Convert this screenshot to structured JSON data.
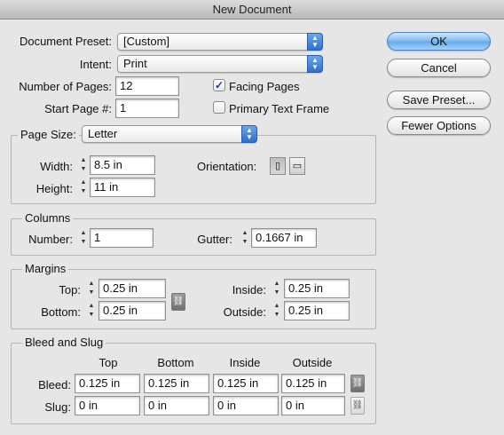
{
  "window": {
    "title": "New Document"
  },
  "document_preset": {
    "label": "Document Preset:",
    "value": "[Custom]"
  },
  "intent": {
    "label": "Intent:",
    "value": "Print"
  },
  "number_of_pages": {
    "label": "Number of Pages:",
    "value": "12"
  },
  "start_page": {
    "label": "Start Page #:",
    "value": "1"
  },
  "facing_pages": {
    "label": "Facing Pages",
    "checked": true,
    "mark": "✓"
  },
  "primary_text_frame": {
    "label": "Primary Text Frame",
    "checked": false
  },
  "buttons": {
    "ok": "OK",
    "cancel": "Cancel",
    "save_preset": "Save Preset...",
    "fewer_options": "Fewer Options"
  },
  "page_size": {
    "label": "Page Size:",
    "value": "Letter",
    "width_label": "Width:",
    "width": "8.5 in",
    "height_label": "Height:",
    "height": "11 in",
    "orientation_label": "Orientation:"
  },
  "columns": {
    "title": "Columns",
    "number_label": "Number:",
    "number": "1",
    "gutter_label": "Gutter:",
    "gutter": "0.1667 in"
  },
  "margins": {
    "title": "Margins",
    "top_label": "Top:",
    "top": "0.25 in",
    "bottom_label": "Bottom:",
    "bottom": "0.25 in",
    "inside_label": "Inside:",
    "inside": "0.25 in",
    "outside_label": "Outside:",
    "outside": "0.25 in"
  },
  "bleed_slug": {
    "title": "Bleed and Slug",
    "headers": [
      "Top",
      "Bottom",
      "Inside",
      "Outside"
    ],
    "bleed_label": "Bleed:",
    "bleed": [
      "0.125 in",
      "0.125 in",
      "0.125 in",
      "0.125 in"
    ],
    "slug_label": "Slug:",
    "slug": [
      "0 in",
      "0 in",
      "0 in",
      "0 in"
    ]
  },
  "glyphs": {
    "spin_up": "▲",
    "spin_down": "▼",
    "chain": "⛓",
    "portrait": "▯",
    "landscape": "▭"
  }
}
